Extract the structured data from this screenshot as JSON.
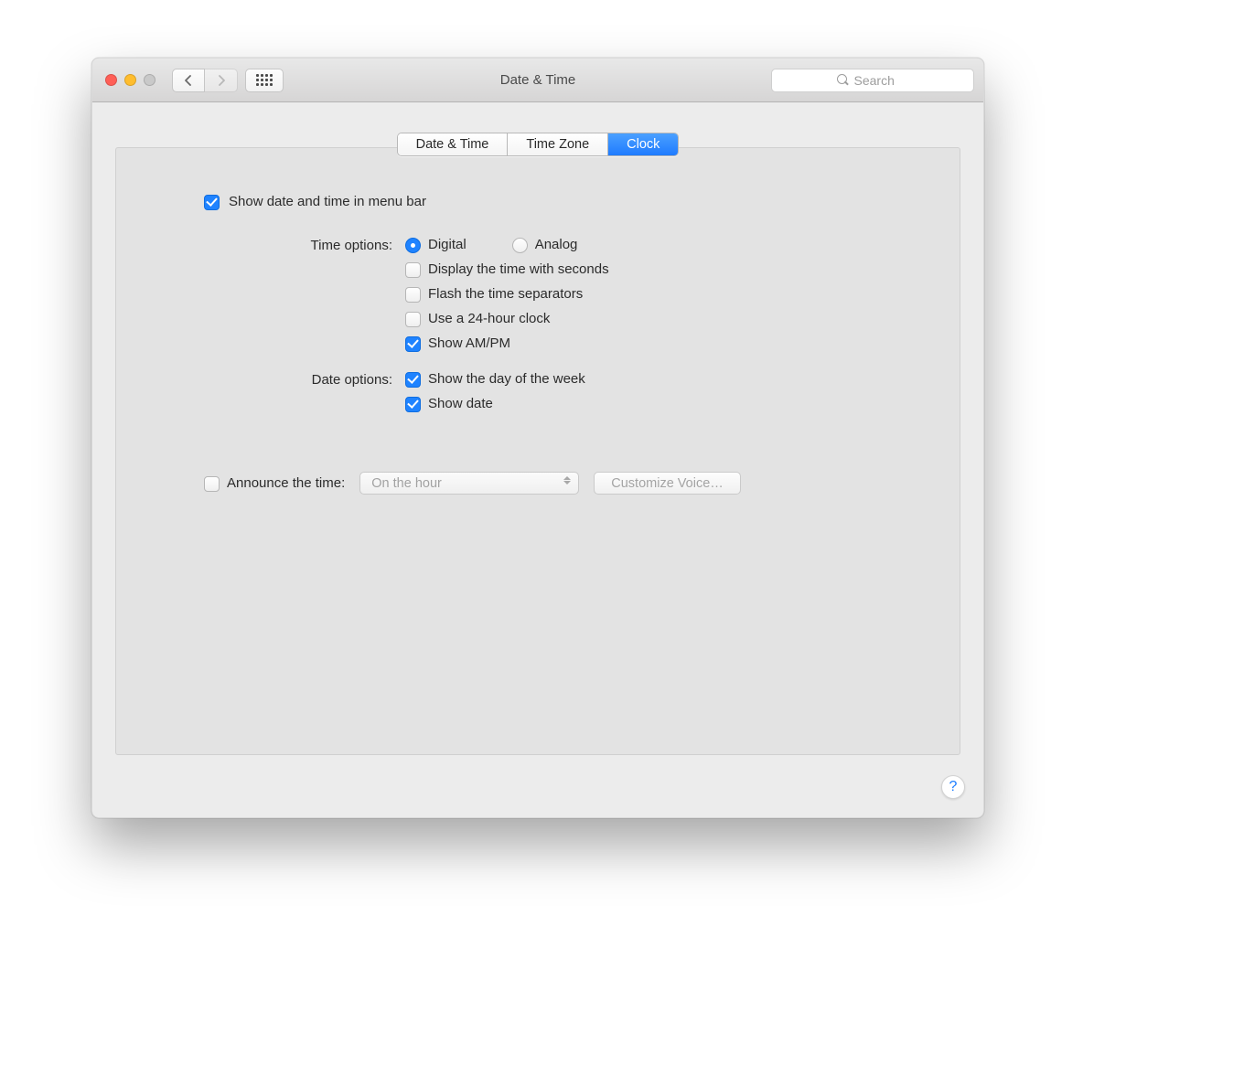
{
  "window": {
    "title": "Date & Time"
  },
  "toolbar": {
    "search_placeholder": "Search"
  },
  "tabs": {
    "date_time": "Date & Time",
    "time_zone": "Time Zone",
    "clock": "Clock",
    "active": "clock"
  },
  "main": {
    "show_in_menubar": "Show date and time in menu bar",
    "time_options_label": "Time options:",
    "time_options": {
      "digital": "Digital",
      "analog": "Analog",
      "display_seconds": "Display the time with seconds",
      "flash_separators": "Flash the time separators",
      "use_24h": "Use a 24-hour clock",
      "show_ampm": "Show AM/PM"
    },
    "date_options_label": "Date options:",
    "date_options": {
      "show_day_of_week": "Show the day of the week",
      "show_date": "Show date"
    },
    "announce_label": "Announce the time:",
    "announce_interval": "On the hour",
    "customize_voice": "Customize Voice…"
  },
  "help": "?"
}
